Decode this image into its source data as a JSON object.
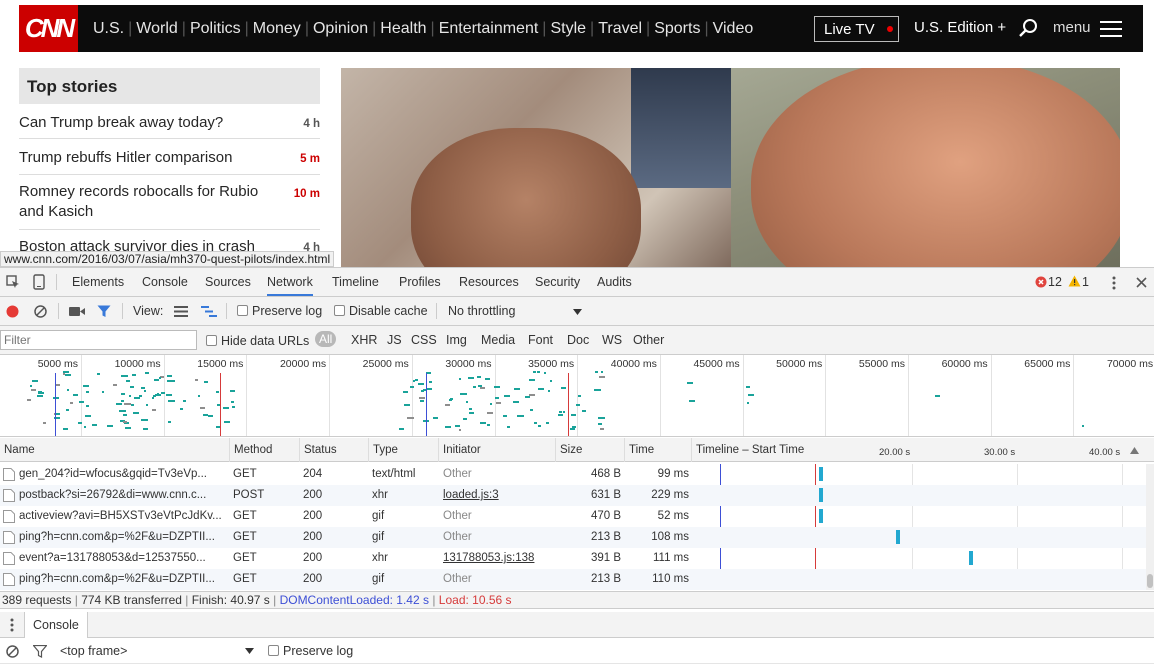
{
  "site": {
    "logo": "CNN",
    "nav": [
      "U.S.",
      "World",
      "Politics",
      "Money",
      "Opinion",
      "Health",
      "Entertainment",
      "Style",
      "Travel",
      "Sports",
      "Video"
    ],
    "live_tv": "Live TV",
    "edition": "U.S. Edition +",
    "menu": "menu"
  },
  "top_stories": {
    "title": "Top stories",
    "items": [
      {
        "text": "Can Trump break away today?",
        "time": "4 h"
      },
      {
        "text": "Trump rebuffs Hitler comparison",
        "time": "5 m"
      },
      {
        "text": "Romney records robocalls for Rubio and Kasich",
        "time": "10 m"
      },
      {
        "text": "Boston attack survivor dies in crash",
        "time": "4 h"
      }
    ]
  },
  "status_url": "www.cnn.com/2016/03/07/asia/mh370-quest-pilots/index.html",
  "devtools": {
    "tabs": [
      "Elements",
      "Console",
      "Sources",
      "Network",
      "Timeline",
      "Profiles",
      "Resources",
      "Security",
      "Audits"
    ],
    "errors": "12",
    "warnings": "1",
    "toolbar": {
      "view_label": "View:",
      "preserve_log": "Preserve log",
      "disable_cache": "Disable cache",
      "throttling": "No throttling"
    },
    "filter": {
      "placeholder": "Filter",
      "hide_data_urls": "Hide data URLs",
      "types": [
        "All",
        "XHR",
        "JS",
        "CSS",
        "Img",
        "Media",
        "Font",
        "Doc",
        "WS",
        "Other"
      ]
    },
    "overview_ticks": [
      "5000 ms",
      "10000 ms",
      "15000 ms",
      "20000 ms",
      "25000 ms",
      "30000 ms",
      "35000 ms",
      "40000 ms",
      "45000 ms",
      "50000 ms",
      "55000 ms",
      "60000 ms",
      "65000 ms",
      "70000 ms"
    ],
    "columns": [
      "Name",
      "Method",
      "Status",
      "Type",
      "Initiator",
      "Size",
      "Time",
      "Timeline – Start Time"
    ],
    "timeline_ticks": [
      "20.00 s",
      "30.00 s",
      "40.00 s"
    ],
    "rows": [
      {
        "name": "gen_204?id=wfocus&gqid=Tv3eVp...",
        "method": "GET",
        "status": "204",
        "type": "text/html",
        "initiator": "Other",
        "size": "468 B",
        "time": "99 ms",
        "start": 0.28
      },
      {
        "name": "postback?si=26792&di=www.cnn.c...",
        "method": "POST",
        "status": "200",
        "type": "xhr",
        "initiator": "loaded.js:3",
        "size": "631 B",
        "time": "229 ms",
        "start": 0.28
      },
      {
        "name": "activeview?avi=BH5XSTv3eVtPcJdKv...",
        "method": "GET",
        "status": "200",
        "type": "gif",
        "initiator": "Other",
        "size": "470 B",
        "time": "52 ms",
        "start": 0.28
      },
      {
        "name": "ping?h=cnn.com&p=%2F&u=DZPTII...",
        "method": "GET",
        "status": "200",
        "type": "gif",
        "initiator": "Other",
        "size": "213 B",
        "time": "108 ms",
        "start": 0.45
      },
      {
        "name": "event?a=131788053&d=12537550...",
        "method": "GET",
        "status": "200",
        "type": "xhr",
        "initiator": "131788053.js:138",
        "size": "391 B",
        "time": "111 ms",
        "start": 0.61
      },
      {
        "name": "ping?h=cnn.com&p=%2F&u=DZPTII...",
        "method": "GET",
        "status": "200",
        "type": "gif",
        "initiator": "Other",
        "size": "213 B",
        "time": "110 ms",
        "start": null
      }
    ],
    "summary": {
      "requests": "389 requests",
      "transferred": "774 KB transferred",
      "finish": "Finish: 40.97 s",
      "dcl": "DOMContentLoaded: 1.42 s",
      "load": "Load: 10.56 s"
    },
    "drawer_tab": "Console",
    "console_context": "<top frame>",
    "console_preserve_log": "Preserve log",
    "colors": {
      "dcl": "#3d4fd6",
      "load": "#d63a3a",
      "bar": "#1aa39a",
      "accent": "#3879d9"
    }
  }
}
